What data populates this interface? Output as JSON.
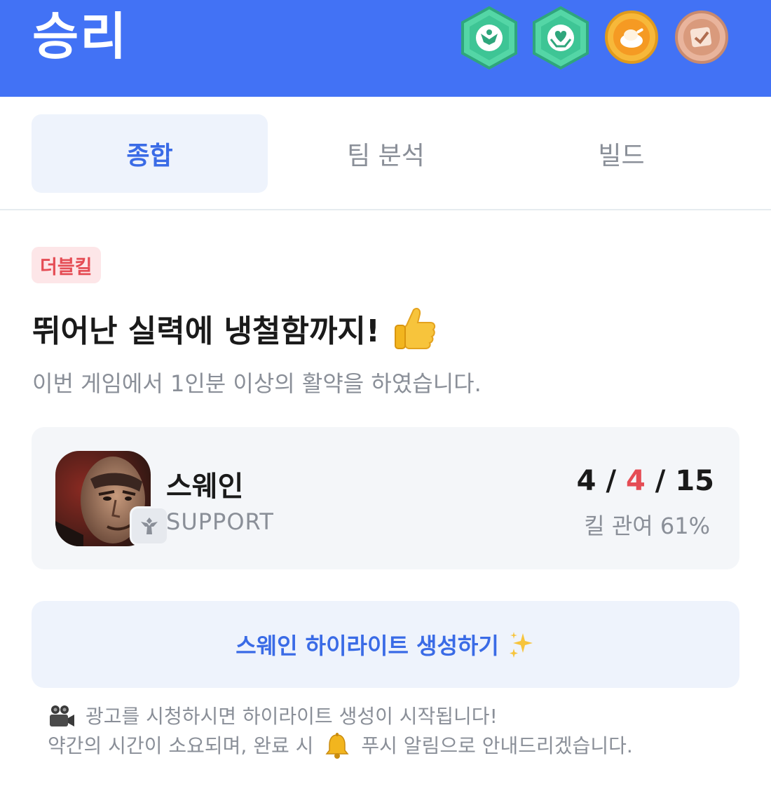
{
  "header": {
    "title": "승리",
    "badges": [
      "angel-badge-icon",
      "heart-hands-badge-icon",
      "chicken-coin-badge-icon",
      "check-stamp-badge-icon"
    ]
  },
  "tabs": [
    {
      "label": "종합",
      "active": true
    },
    {
      "label": "팀 분석",
      "active": false
    },
    {
      "label": "빌드",
      "active": false
    }
  ],
  "result": {
    "tag": "더블킬",
    "headline": "뛰어난 실력에 냉철함까지!",
    "description": "이번 게임에서 1인분 이상의 활약을 하였습니다."
  },
  "champion": {
    "name": "스웨인",
    "role": "SUPPORT",
    "kills": "4",
    "deaths": "4",
    "assists": "15",
    "separator": "/",
    "kill_participation": "킬 관여 61%"
  },
  "cta": {
    "label": "스웨인 하이라이트 생성하기"
  },
  "notice": {
    "line1": "광고를 시청하시면 하이라이트 생성이 시작됩니다!",
    "line2_before": "약간의 시간이 소요되며, 완료 시",
    "line2_after": "푸시 알림으로 안내드리겠습니다."
  },
  "colors": {
    "header_bg": "#4272f5",
    "accent": "#3a6be6",
    "danger": "#e54d55",
    "muted": "#8a8f98"
  }
}
